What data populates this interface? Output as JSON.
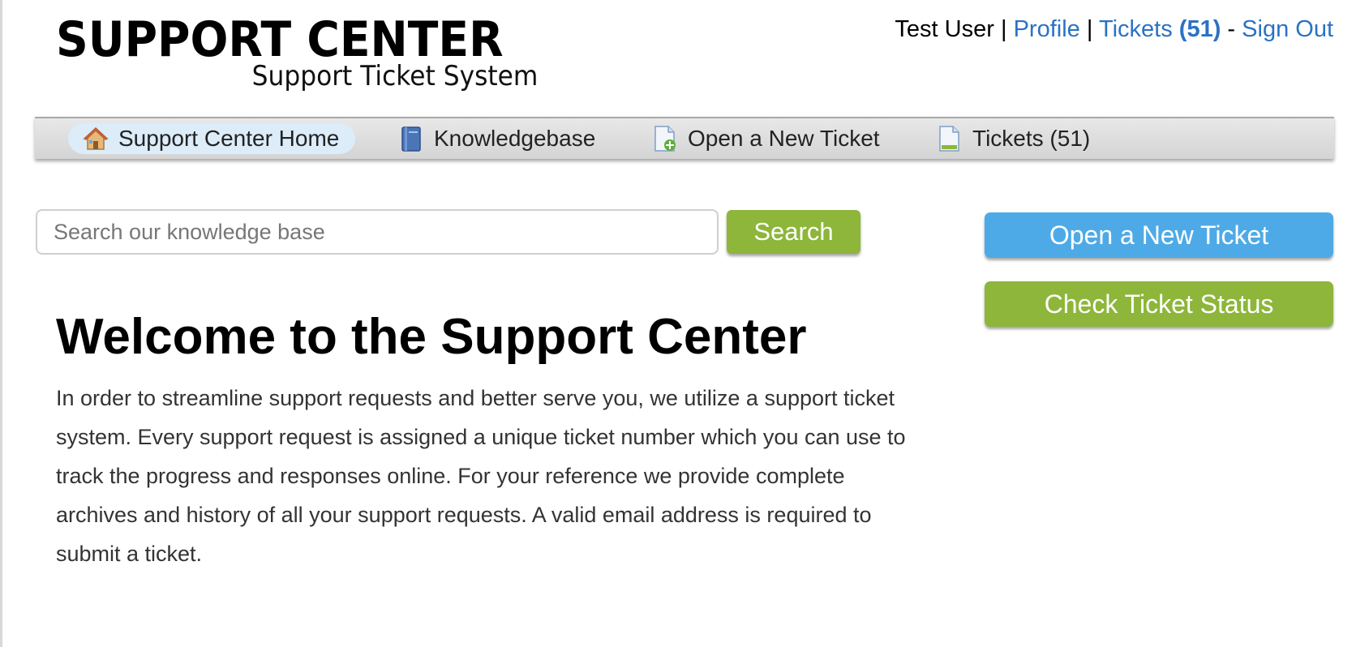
{
  "header": {
    "logo_title": "SUPPORT CENTER",
    "logo_subtitle": "Support Ticket System"
  },
  "userbar": {
    "user_name": "Test User",
    "sep1": "|",
    "profile_label": "Profile",
    "sep2": "|",
    "tickets_label": "Tickets",
    "tickets_count": "(51)",
    "sep3": "-",
    "signout_label": "Sign Out"
  },
  "nav": {
    "items": [
      {
        "label": "Support Center Home",
        "icon": "home-icon"
      },
      {
        "label": "Knowledgebase",
        "icon": "book-icon"
      },
      {
        "label": "Open a New Ticket",
        "icon": "new-ticket-icon"
      },
      {
        "label": "Tickets (51)",
        "icon": "ticket-icon"
      }
    ]
  },
  "search": {
    "placeholder": "Search our knowledge base",
    "value": "",
    "button_label": "Search"
  },
  "sidebar": {
    "open_ticket_label": "Open a New Ticket",
    "check_status_label": "Check Ticket Status"
  },
  "main": {
    "title": "Welcome to the Support Center",
    "body": "In order to streamline support requests and better serve you, we utilize a support ticket system. Every support request is assigned a unique ticket number which you can use to track the progress and responses online. For your reference we provide complete archives and history of all your support requests. A valid email address is required to submit a ticket."
  },
  "colors": {
    "link": "#2a72c4",
    "green_button": "#8db63a",
    "blue_button": "#4eaae6",
    "active_nav": "#dcecf9"
  }
}
